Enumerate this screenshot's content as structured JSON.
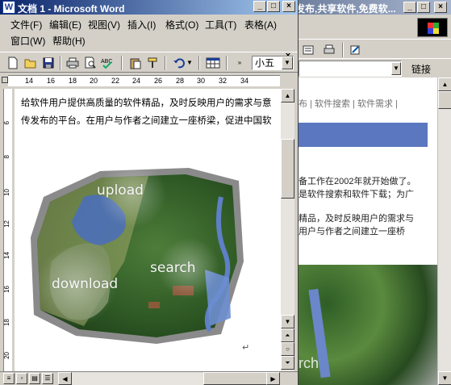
{
  "word": {
    "title": "文档 1 - Microsoft Word",
    "app_icon_glyph": "W",
    "window_buttons": {
      "minimize": "_",
      "maximize": "□",
      "close": "×"
    },
    "menu": [
      "文件(F)",
      "编辑(E)",
      "视图(V)",
      "插入(I)",
      "格式(O)",
      "工具(T)",
      "表格(A)",
      "窗口(W)",
      "帮助(H)"
    ],
    "doc_close": "×",
    "font_size": "小五",
    "ruler_numbers": [
      "14",
      "16",
      "18",
      "20",
      "22",
      "24",
      "26",
      "28",
      "30",
      "32",
      "34"
    ],
    "vruler_numbers": [
      "6",
      "8",
      "10",
      "12",
      "14",
      "16",
      "18",
      "20"
    ],
    "document_lines": [
      "给软件用户提供高质量的软件精品，及时反映用户的需求与意",
      "传发布的平台。在用户与作者之间建立一座桥梁，促进中国软"
    ],
    "image_watermarks": {
      "upload": "upload",
      "search": "search",
      "download": "download"
    },
    "paragraph_mark": "↵"
  },
  "browser": {
    "title": "发布,共享软件,免费软...",
    "window_buttons": {
      "minimize": "_",
      "maximize": "□",
      "close": "×"
    },
    "links_label": "链接",
    "nav_text": "布 | 软件搜索 | 软件需求 |",
    "paragraphs": [
      "备工作在2002年就开始做了。",
      "是软件搜索和软件下载；为广",
      "精品，及时反映用户的需求与",
      "用户与作者之间建立一座桥"
    ],
    "image_word": "rch"
  },
  "colors": {
    "word_title_start": "#0a246a",
    "word_title_end": "#a6caf0",
    "browser_title": "#6b7d9c",
    "browser_bluebar": "#5a77bf"
  },
  "icons": [
    "new-document-icon",
    "open-folder-icon",
    "save-icon",
    "print-icon",
    "print-preview-icon",
    "spellcheck-icon",
    "paste-icon",
    "format-painter-icon",
    "undo-icon",
    "table-icon"
  ]
}
